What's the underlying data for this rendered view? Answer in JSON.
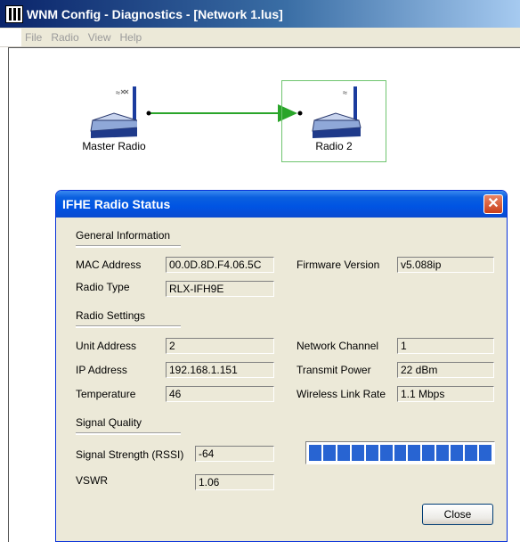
{
  "app": {
    "title": "WNM Config - Diagnostics - [Network 1.lus]"
  },
  "menu": [
    "File",
    "Radio",
    "View",
    "Help"
  ],
  "network": {
    "nodes": [
      {
        "label": "Master Radio"
      },
      {
        "label": "Radio 2"
      }
    ],
    "link_color": "#2aa52a"
  },
  "dialog": {
    "title": "IFHE Radio Status",
    "general": {
      "heading": "General Information",
      "mac_label": "MAC Address",
      "mac_value": "00.0D.8D.F4.06.5C",
      "type_label": "Radio Type",
      "type_value": "RLX-IFH9E",
      "fw_label": "Firmware Version",
      "fw_value": "v5.088ip"
    },
    "settings": {
      "heading": "Radio Settings",
      "unit_label": "Unit Address",
      "unit_value": "2",
      "ip_label": "IP Address",
      "ip_value": "192.168.1.151",
      "temp_label": "Temperature",
      "temp_value": "46",
      "channel_label": "Network Channel",
      "channel_value": "1",
      "power_label": "Transmit Power",
      "power_value": "22 dBm",
      "rate_label": "Wireless Link Rate",
      "rate_value": "1.1 Mbps"
    },
    "signal": {
      "heading": "Signal Quality",
      "rssi_label": "Signal Strength (RSSI)",
      "rssi_value": "-64",
      "vswr_label": "VSWR",
      "vswr_value": "1.06",
      "meter_segments_filled": 13,
      "meter_color": "#2864d2"
    },
    "close_label": "Close"
  }
}
